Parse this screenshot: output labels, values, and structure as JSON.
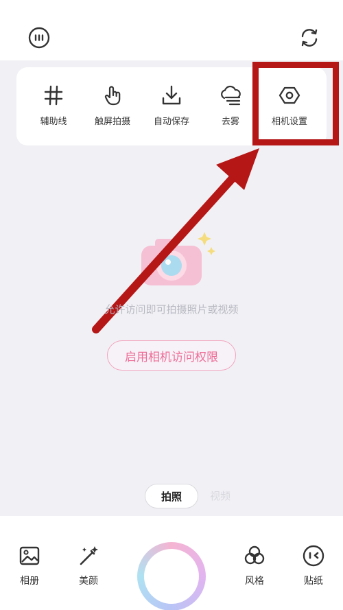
{
  "header": {
    "more_icon": "more-horizontal-circle-icon",
    "switch_icon": "switch-camera-icon"
  },
  "tools": [
    {
      "label": "辅助线",
      "icon": "grid-icon"
    },
    {
      "label": "触屏拍摄",
      "icon": "touch-icon"
    },
    {
      "label": "自动保存",
      "icon": "download-icon"
    },
    {
      "label": "去雾",
      "icon": "defog-icon"
    },
    {
      "label": "相机设置",
      "icon": "settings-icon"
    }
  ],
  "main": {
    "permission_hint": "允许访问即可拍摄照片或视频",
    "enable_button": "启用相机访问权限"
  },
  "modes": {
    "photo": "拍照",
    "video": "视频"
  },
  "bottom_nav": {
    "album": "相册",
    "beauty": "美颜",
    "style": "风格",
    "sticker": "贴纸"
  },
  "colors": {
    "highlight": "#b51616",
    "accent_pink": "#ee6d98",
    "background": "#f1f1f5"
  }
}
